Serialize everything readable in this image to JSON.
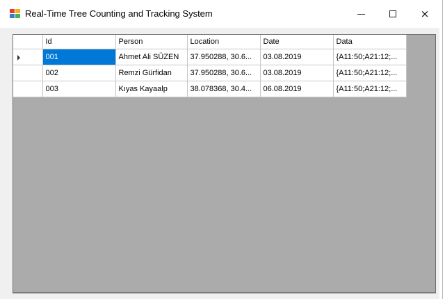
{
  "window": {
    "title": "Real-Time Tree Counting and Tracking System",
    "icon": "app-icon",
    "controls": {
      "minimize": "minimize-icon",
      "maximize": "maximize-icon",
      "close": "×"
    }
  },
  "grid": {
    "columns": [
      "Id",
      "Person",
      "Location",
      "Date",
      "Data"
    ],
    "rows": [
      {
        "id": "001",
        "person": "Ahmet Ali SÜZEN",
        "location": "37.950288, 30.6...",
        "date": "03.08.2019",
        "data": "{A11:50;A21:12;..."
      },
      {
        "id": "002",
        "person": "Remzi Gürfidan",
        "location": "37.950288, 30.6...",
        "date": "03.08.2019",
        "data": "{A11:50;A21:12;..."
      },
      {
        "id": "003",
        "person": "Kıyas Kayaalp",
        "location": "38.078368, 30.4...",
        "date": "06.08.2019",
        "data": "{A11:50;A21:12;..."
      }
    ],
    "current_row_indicator": "row-arrow-icon",
    "selected_cell": "001",
    "colors": {
      "selection": "#0078d7",
      "background": "#ababab"
    }
  }
}
